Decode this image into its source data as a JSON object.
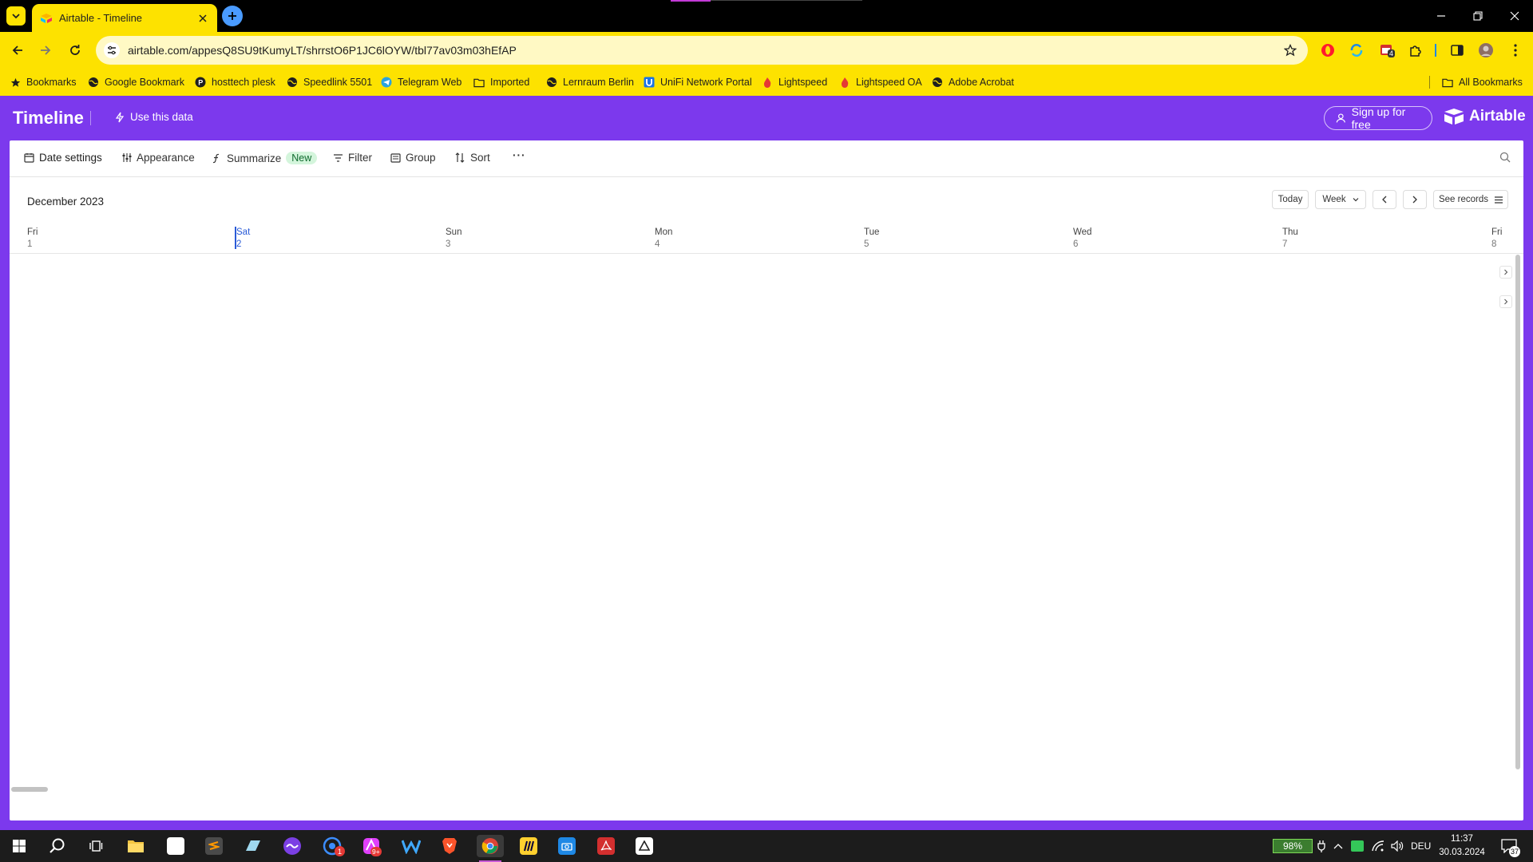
{
  "browser": {
    "tab": {
      "title": "Airtable - Timeline"
    },
    "url": "airtable.com/appesQ8SU9tKumyLT/shrrstO6P1JC6lOYW/tbl77av03m03hEfAP",
    "extension_badge": "4",
    "bookmarks": [
      {
        "label": "Bookmarks",
        "icon": "star-icon"
      },
      {
        "label": "Google Bookmark",
        "icon": "globe-icon"
      },
      {
        "label": "hosttech plesk",
        "icon": "plesk-icon"
      },
      {
        "label": "Speedlink 5501",
        "icon": "globe-icon"
      },
      {
        "label": "Telegram Web",
        "icon": "telegram-icon"
      },
      {
        "label": "Imported",
        "icon": "folder-icon"
      },
      {
        "label": "Lernraum Berlin",
        "icon": "globe-icon"
      },
      {
        "label": "UniFi Network Portal",
        "icon": "unifi-icon"
      },
      {
        "label": "Lightspeed",
        "icon": "flame-icon"
      },
      {
        "label": "Lightspeed OA",
        "icon": "flame-icon"
      },
      {
        "label": "Adobe Acrobat",
        "icon": "globe-icon"
      }
    ],
    "all_bookmarks": "All Bookmarks"
  },
  "app": {
    "title": "Timeline",
    "use_data": "Use this data",
    "signup": "Sign up for free",
    "brand": "Airtable",
    "colors": {
      "header": "#7c39ed",
      "browser": "#fde200"
    }
  },
  "viewbar": {
    "date_settings": "Date settings",
    "appearance": "Appearance",
    "summarize": "Summarize",
    "summarize_badge": "New",
    "filter": "Filter",
    "group": "Group",
    "sort": "Sort",
    "more": "···"
  },
  "timeline": {
    "month": "December 2023",
    "today": "Today",
    "range": "Week",
    "see_records": "See records",
    "days": [
      {
        "name": "Fri",
        "num": "1"
      },
      {
        "name": "Sat",
        "num": "2"
      },
      {
        "name": "Sun",
        "num": "3"
      },
      {
        "name": "Mon",
        "num": "4"
      },
      {
        "name": "Tue",
        "num": "5"
      },
      {
        "name": "Wed",
        "num": "6"
      },
      {
        "name": "Thu",
        "num": "7"
      },
      {
        "name": "Fri",
        "num": "8"
      }
    ]
  },
  "taskbar": {
    "battery": "98%",
    "language": "DEU",
    "time": "11:37",
    "date": "30.03.2024",
    "notifications": "37",
    "badge_app1": "1",
    "badge_app2": "9+"
  }
}
